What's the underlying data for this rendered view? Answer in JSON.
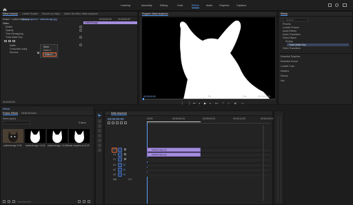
{
  "topbar": {
    "workspaces": [
      "Learning",
      "Assembly",
      "Editing",
      "Color",
      "Effects",
      "Audio",
      "Graphics",
      "Captions"
    ],
    "active_workspace": "Effects"
  },
  "effect_controls": {
    "tabs": [
      "Effect Controls",
      "Lumetri Scopes",
      "Source: (no clips)",
      "Audio Clip Mixer: Mask sequence"
    ],
    "source": "Master * walkerimage.jpg",
    "seq": "Mask sequence * walkerimage.jpg",
    "section_video": "Video",
    "rows": [
      "Motion",
      "Opacity",
      "Time Remapping",
      "Track Matte Key"
    ],
    "matte_label": "Matte:",
    "matte_value": "None",
    "composite_label": "Composite using",
    "composite_value": "Matte Alpha",
    "reverse_label": "Reverse",
    "dropdown_options": [
      "None",
      "Video 1",
      "Video 2"
    ],
    "dropdown_selected": "Video 2",
    "time_label": "00:00:05:00",
    "timecode": "00:00:00:00"
  },
  "program": {
    "title": "Program: Mask sequence",
    "timecode": "00:00:00:00",
    "fit": "Fit",
    "quality": "Full",
    "duration": "00:00:15:29"
  },
  "effects_panel": {
    "title": "Effects",
    "search_placeholder": "Search",
    "tree": [
      "Presets",
      "Lumetri Presets",
      "Audio Effects",
      "Audio Transitions",
      "Video Effects",
      "Keying",
      "Track Matte Key",
      "Video Transitions"
    ],
    "sections": [
      "Essential Graphics",
      "Essential Sound",
      "Lumetri Color",
      "Markers",
      "History",
      "Info"
    ]
  },
  "project": {
    "panel_title": "Effects",
    "tabs": [
      "Project: Effects",
      "Media Browser"
    ],
    "file": "Demo.prproj",
    "item_count": "5 items",
    "items": [
      {
        "name": "walkerimage",
        "meta": "5:00"
      },
      {
        "name": "walkerimage",
        "meta": "13:04"
      },
      {
        "name": "walkerimage",
        "meta": "13:04"
      },
      {
        "name": "Mask sequence",
        "meta": "15:29"
      }
    ]
  },
  "timeline": {
    "title": "Mask sequence",
    "timecode": "00:00:00:00",
    "ruler": [
      "00:00",
      "00:00:04:23",
      "00:00:09:23",
      "00:00:14:23",
      "00:00:19:23"
    ],
    "tracks": [
      "V3",
      "V2",
      "V1",
      "A1",
      "A2",
      "A3",
      "Mix"
    ],
    "clip_v2": "walkerimage.jpg",
    "clip_v1": "walkerimage.jpg",
    "mix_value": "0.0"
  }
}
